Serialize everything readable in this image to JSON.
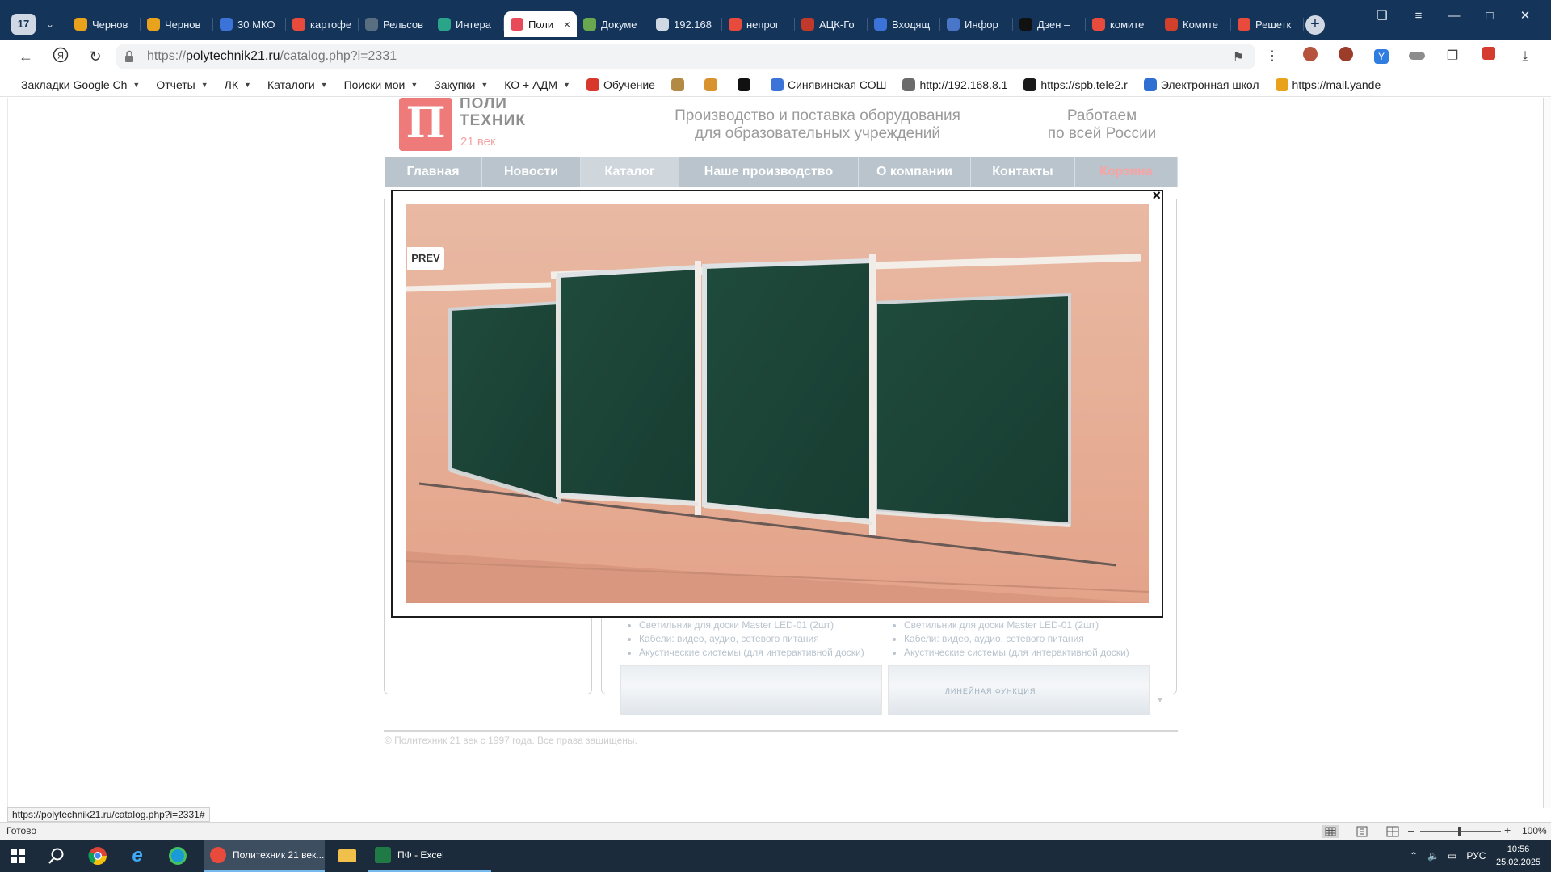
{
  "browser": {
    "tab_count": "17",
    "tabs": [
      {
        "label": "Чернов",
        "icon": "mail-icon",
        "color": "#e9a21c"
      },
      {
        "label": "Чернов",
        "icon": "mail-icon",
        "color": "#e9a21c"
      },
      {
        "label": "30 МКО",
        "icon": "cube-icon",
        "color": "#3c73d8"
      },
      {
        "label": "картофе",
        "icon": "yandex-icon",
        "color": "#e84a3c"
      },
      {
        "label": "Рельсов",
        "icon": "pen-icon",
        "color": "#5a6e82"
      },
      {
        "label": "Интера",
        "icon": "gpt-icon",
        "color": "#2aa58a"
      },
      {
        "label": "Поли",
        "icon": "polytechnik-icon",
        "color": "#e84a5a"
      },
      {
        "label": "Докуме",
        "icon": "doc-icon",
        "color": "#6aa84f"
      },
      {
        "label": "192.168",
        "icon": "page-icon",
        "color": "#cfd8e3"
      },
      {
        "label": "непрог",
        "icon": "yandex-icon",
        "color": "#e84a3c"
      },
      {
        "label": "АЦК-Го",
        "icon": "ack-icon",
        "color": "#c0392b"
      },
      {
        "label": "Входящ",
        "icon": "arrow-icon",
        "color": "#3c73d8"
      },
      {
        "label": "Инфор",
        "icon": "info-icon",
        "color": "#4a76c9"
      },
      {
        "label": "Дзен –",
        "icon": "zen-icon",
        "color": "#111111"
      },
      {
        "label": "комите",
        "icon": "yandex-icon",
        "color": "#e84a3c"
      },
      {
        "label": "Комите",
        "icon": "gerb-icon",
        "color": "#d1402a"
      },
      {
        "label": "Решетк",
        "icon": "opera-icon",
        "color": "#e84a3c"
      }
    ],
    "active_tab_index": 6,
    "url_host": "polytechnik21.ru",
    "url_prefix": "https://",
    "url_path": "/catalog.php?i=2331",
    "bookmarks": [
      {
        "label": "Закладки Google Ch",
        "caret": true,
        "icon": ""
      },
      {
        "label": "Отчеты",
        "caret": true,
        "icon": ""
      },
      {
        "label": "ЛК",
        "caret": true,
        "icon": ""
      },
      {
        "label": "Каталоги",
        "caret": true,
        "icon": ""
      },
      {
        "label": "Поиски мои",
        "caret": true,
        "icon": ""
      },
      {
        "label": "Закупки",
        "caret": true,
        "icon": ""
      },
      {
        "label": "КО + АДМ",
        "caret": true,
        "icon": ""
      },
      {
        "label": "Обучение",
        "caret": false,
        "icon": "calendar-icon"
      },
      {
        "label": "",
        "caret": false,
        "icon": "scales-icon"
      },
      {
        "label": "",
        "caret": false,
        "icon": "chick-icon"
      },
      {
        "label": "",
        "caret": false,
        "icon": "circle-icon"
      },
      {
        "label": "Синявинская СОШ",
        "caret": false,
        "icon": "doc-icon"
      },
      {
        "label": "http://192.168.8.1",
        "caret": false,
        "icon": "page-icon"
      },
      {
        "label": "https://spb.tele2.r",
        "caret": false,
        "icon": "tele2-icon"
      },
      {
        "label": "Электронная школ",
        "caret": false,
        "icon": "school-icon"
      },
      {
        "label": "https://mail.yande",
        "caret": false,
        "icon": "mail-icon"
      }
    ]
  },
  "site": {
    "logo_letter": "П",
    "logo_line1": "ПОЛИ",
    "logo_line2": "ТЕХНИК",
    "logo_sub": "21 век",
    "slogan_1a": "Производство и поставка оборудования",
    "slogan_1b": "для образовательных учреждений",
    "slogan_2a": "Работаем",
    "slogan_2b": "по всей России",
    "nav": [
      "Главная",
      "Новости",
      "Каталог",
      "Наше производство",
      "О компании",
      "Контакты",
      "Корзина"
    ],
    "nav_active": "Каталог",
    "list_items": [
      "Светильник для доски Master LED-01 (2шт)",
      "Кабели: видео, аудио, сетевого питания",
      "Акустические системы (для интерактивной доски)"
    ],
    "thumb_caption": "ЛИНЕЙНАЯ ФУНКЦИЯ",
    "copyright": "© Политехник 21 век с 1997 года. Все права защищены."
  },
  "lightbox": {
    "prev_label": "PREV",
    "close_label": "×"
  },
  "status": {
    "hover_url": "https://polytechnik21.ru/catalog.php?i=2331#",
    "excel_status": "Готово",
    "zoom": "100%"
  },
  "taskbar": {
    "apps": [
      {
        "label": "Политехник 21 век...",
        "icon": "yandex-browser-icon",
        "state": "active"
      },
      {
        "label": "ПФ - Excel",
        "icon": "excel-icon",
        "state": "open"
      }
    ],
    "language": "РУС",
    "time": "10:56",
    "date": "25.02.2025"
  },
  "colors": {
    "chrome_dark": "#14345a",
    "brand_pink": "#ee7a7a",
    "nav_gray": "#b9c4cd",
    "board_green": "#1f4a3a",
    "wall_peach": "#e9b49d"
  }
}
